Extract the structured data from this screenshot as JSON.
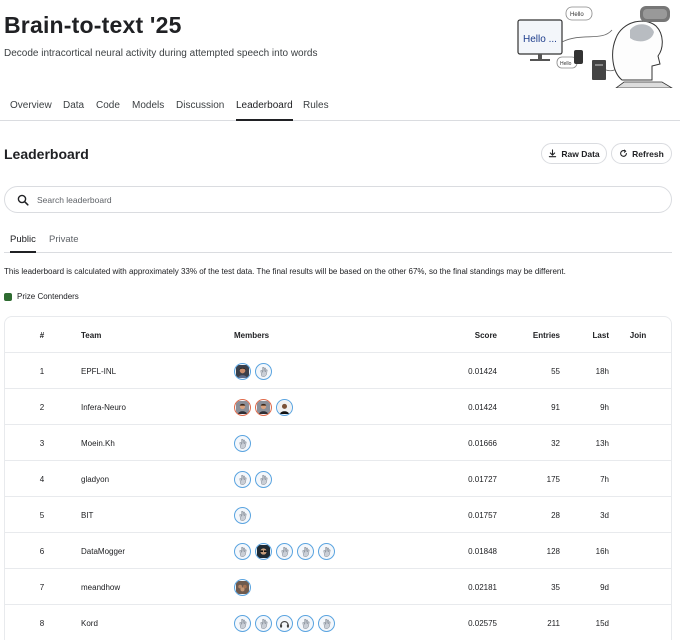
{
  "competition": {
    "title": "Brain-to-text '25",
    "subtitle": "Decode intracortical neural activity during attempted speech into words",
    "banner_screen_text": "Hello ...",
    "banner_bubbles": [
      "Hello",
      "Hello"
    ]
  },
  "nav": {
    "tabs": [
      "Overview",
      "Data",
      "Code",
      "Models",
      "Discussion",
      "Leaderboard",
      "Rules"
    ],
    "active": "Leaderboard"
  },
  "leaderboard": {
    "title": "Leaderboard",
    "raw_data_label": "Raw Data",
    "refresh_label": "Refresh",
    "search_placeholder": "Search leaderboard",
    "subtabs": [
      "Public",
      "Private"
    ],
    "active_subtab": "Public",
    "notice": "This leaderboard is calculated with approximately 33% of the test data. The final results will be based on the other 67%, so the final standings may be different.",
    "legend_label": "Prize Contenders",
    "legend_color": "#2e6b30",
    "columns": [
      "#",
      "Team",
      "Members",
      "Score",
      "Entries",
      "Last",
      "Join"
    ],
    "rows": [
      {
        "rank": "1",
        "team": "EPFL-INL",
        "members": [
          "photo-woman",
          "hand"
        ],
        "score": "0.01424",
        "entries": "55",
        "last": "18h"
      },
      {
        "rank": "2",
        "team": "Infera-Neuro",
        "members": [
          "photo-man-red",
          "photo-man-red",
          "photo-man"
        ],
        "score": "0.01424",
        "entries": "91",
        "last": "9h"
      },
      {
        "rank": "3",
        "team": "Moein.Kh",
        "members": [
          "hand"
        ],
        "score": "0.01666",
        "entries": "32",
        "last": "13h"
      },
      {
        "rank": "4",
        "team": "gladyon",
        "members": [
          "hand",
          "hand"
        ],
        "score": "0.01727",
        "entries": "175",
        "last": "7h"
      },
      {
        "rank": "5",
        "team": "BIT",
        "members": [
          "hand"
        ],
        "score": "0.01757",
        "entries": "28",
        "last": "3d"
      },
      {
        "rank": "6",
        "team": "DataMogger",
        "members": [
          "hand",
          "photo-glasses",
          "hand",
          "hand",
          "hand"
        ],
        "score": "0.01848",
        "entries": "128",
        "last": "16h"
      },
      {
        "rank": "7",
        "team": "meandhow",
        "members": [
          "photo-group"
        ],
        "score": "0.02181",
        "entries": "35",
        "last": "9d"
      },
      {
        "rank": "8",
        "team": "Kord",
        "members": [
          "hand",
          "hand",
          "headphones",
          "hand",
          "hand"
        ],
        "score": "0.02575",
        "entries": "211",
        "last": "15d"
      }
    ]
  }
}
